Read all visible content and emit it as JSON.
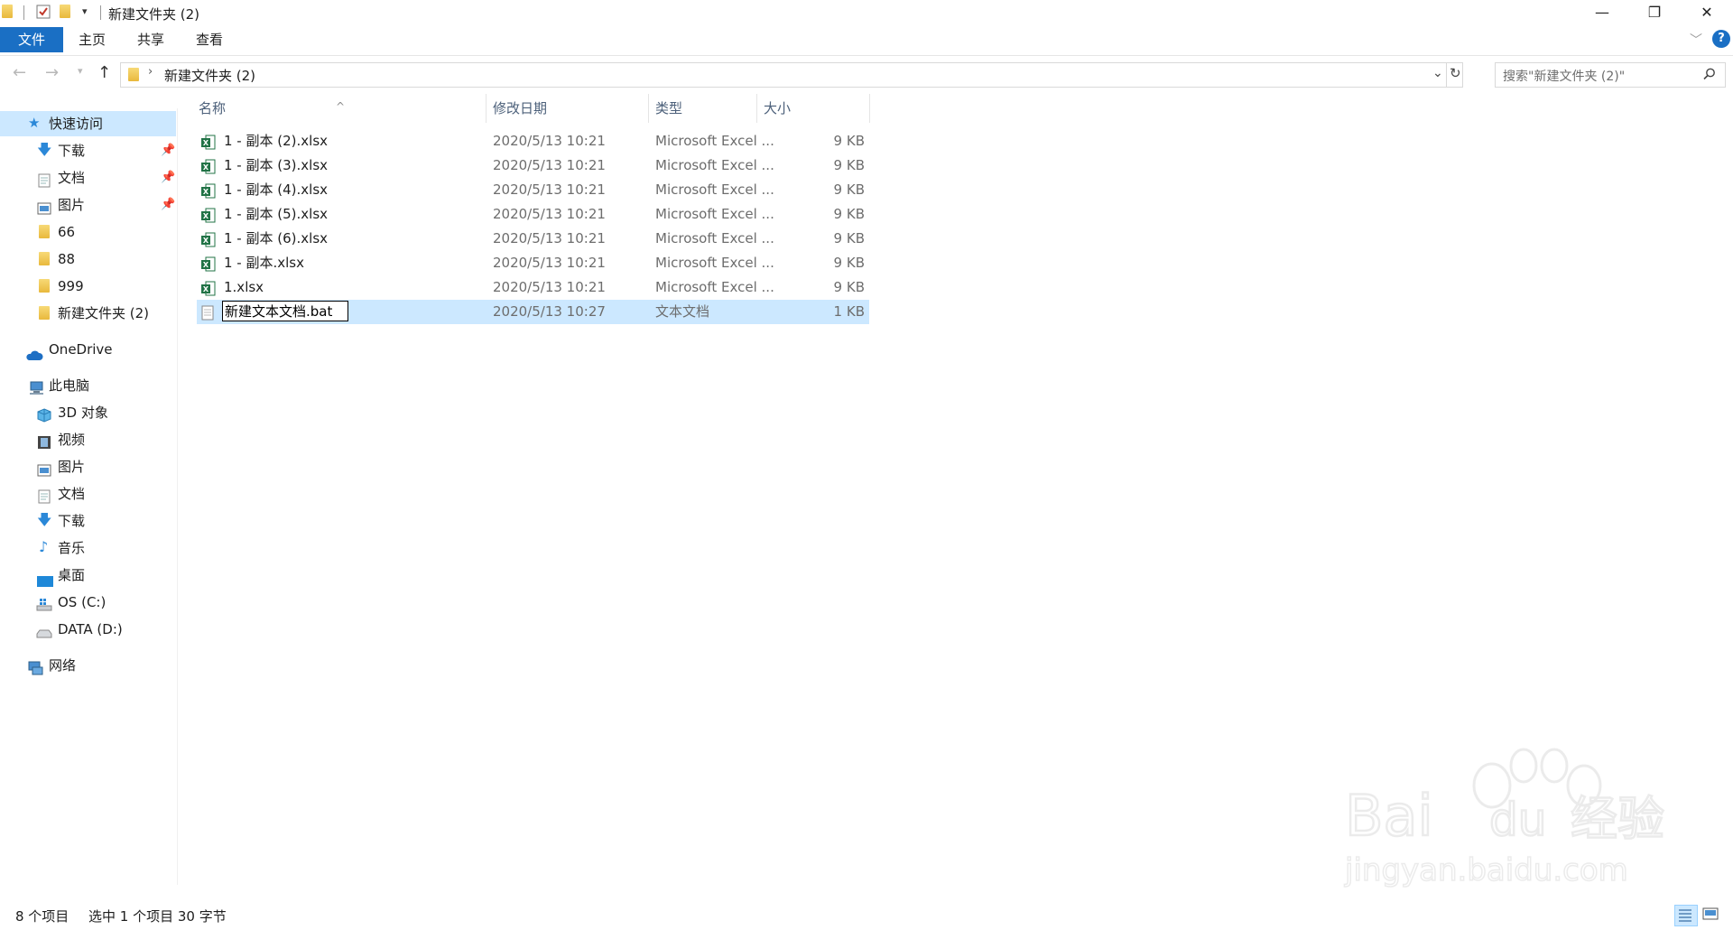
{
  "window": {
    "title": "新建文件夹 (2)",
    "minimize": "—",
    "maximize": "❐",
    "close": "✕"
  },
  "ribbon": {
    "tabs": [
      "文件",
      "主页",
      "共享",
      "查看"
    ],
    "help": "?"
  },
  "address": {
    "path": "新建文件夹 (2)",
    "search_placeholder": "搜索\"新建文件夹 (2)\""
  },
  "sidebar": {
    "quick_access": "快速访问",
    "quick_items": [
      {
        "label": "下载",
        "pinned": true
      },
      {
        "label": "文档",
        "pinned": true
      },
      {
        "label": "图片",
        "pinned": true
      },
      {
        "label": "66",
        "pinned": false
      },
      {
        "label": "88",
        "pinned": false
      },
      {
        "label": "999",
        "pinned": false
      },
      {
        "label": "新建文件夹 (2)",
        "pinned": false
      }
    ],
    "onedrive": "OneDrive",
    "this_pc": "此电脑",
    "pc_items": [
      "3D 对象",
      "视频",
      "图片",
      "文档",
      "下载",
      "音乐",
      "桌面",
      "OS (C:)",
      "DATA (D:)"
    ],
    "network": "网络"
  },
  "columns": {
    "name": "名称",
    "date": "修改日期",
    "type": "类型",
    "size": "大小"
  },
  "files": [
    {
      "name": "1 - 副本 (2).xlsx",
      "date": "2020/5/13 10:21",
      "type": "Microsoft Excel ...",
      "size": "9 KB"
    },
    {
      "name": "1 - 副本 (3).xlsx",
      "date": "2020/5/13 10:21",
      "type": "Microsoft Excel ...",
      "size": "9 KB"
    },
    {
      "name": "1 - 副本 (4).xlsx",
      "date": "2020/5/13 10:21",
      "type": "Microsoft Excel ...",
      "size": "9 KB"
    },
    {
      "name": "1 - 副本 (5).xlsx",
      "date": "2020/5/13 10:21",
      "type": "Microsoft Excel ...",
      "size": "9 KB"
    },
    {
      "name": "1 - 副本 (6).xlsx",
      "date": "2020/5/13 10:21",
      "type": "Microsoft Excel ...",
      "size": "9 KB"
    },
    {
      "name": "1 - 副本.xlsx",
      "date": "2020/5/13 10:21",
      "type": "Microsoft Excel ...",
      "size": "9 KB"
    },
    {
      "name": "1.xlsx",
      "date": "2020/5/13 10:21",
      "type": "Microsoft Excel ...",
      "size": "9 KB"
    },
    {
      "name": "新建文本文档.bat",
      "date": "2020/5/13 10:27",
      "type": "文本文档",
      "size": "1 KB"
    }
  ],
  "status": {
    "count": "8 个项目",
    "selection": "选中 1 个项目  30 字节"
  },
  "watermark": {
    "brand": "Bai",
    "brand_mid": "du",
    "brand_cn": "经验",
    "domain": "jingyan.baidu.com"
  },
  "colors": {
    "accent": "#1a6fc4",
    "selection": "#cce8ff",
    "header_text": "#4c607a"
  }
}
